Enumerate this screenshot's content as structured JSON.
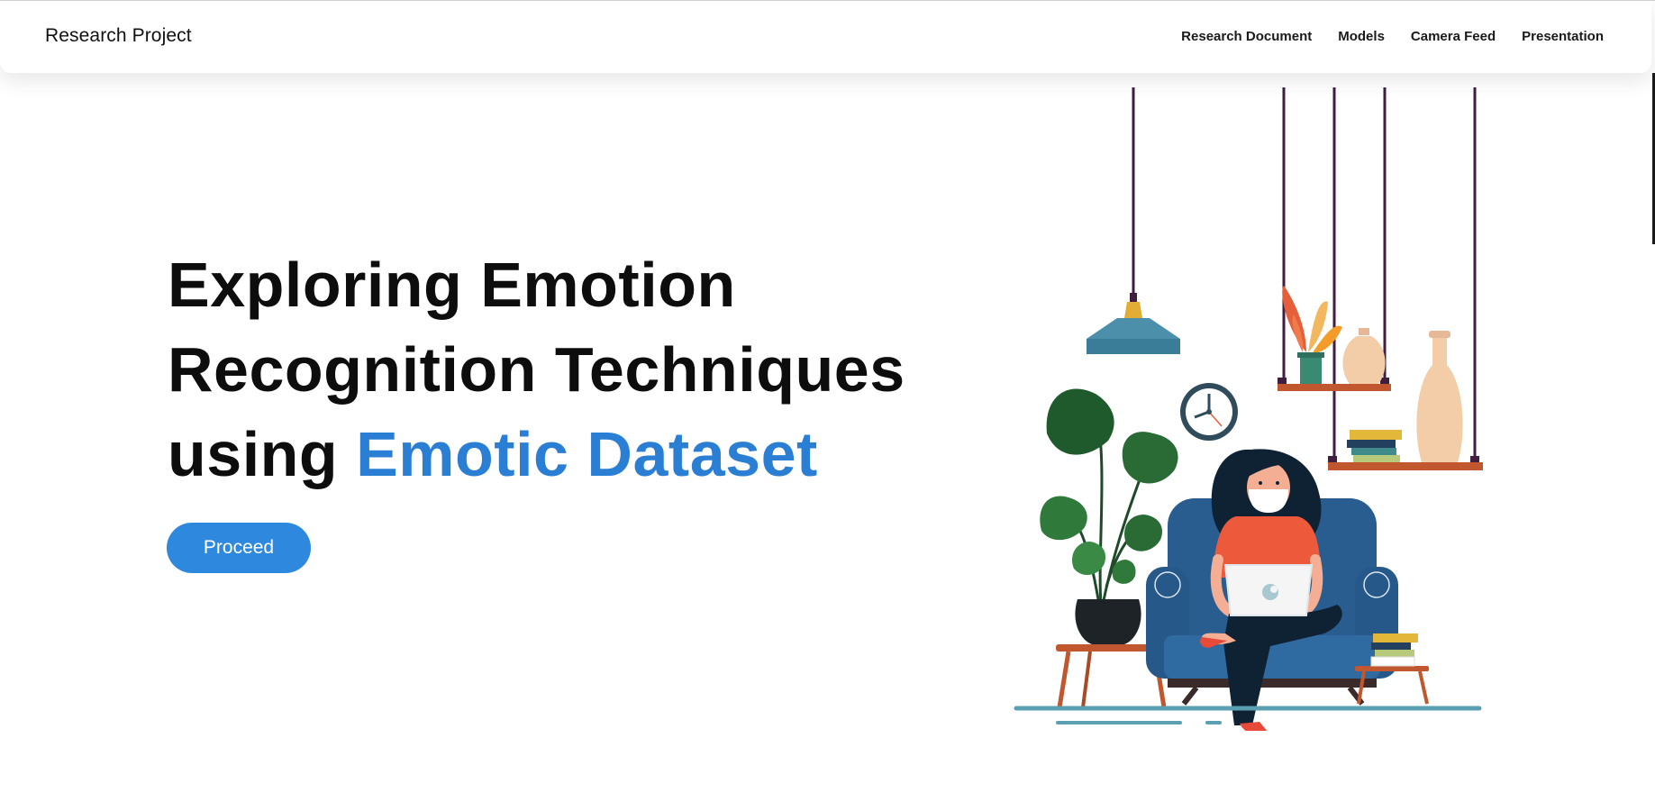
{
  "header": {
    "brand": "Research Project",
    "nav": [
      {
        "label": "Research Document"
      },
      {
        "label": "Models"
      },
      {
        "label": "Camera Feed"
      },
      {
        "label": "Presentation"
      }
    ]
  },
  "hero": {
    "title_line1": "Exploring Emotion",
    "title_line2": "Recognition Techniques",
    "title_line3_prefix": "using ",
    "title_highlight": "Emotic Dataset",
    "button_label": "Proceed"
  },
  "colors": {
    "accent": "#2a7fd4",
    "button": "#2e89de",
    "text": "#0d0d0d"
  },
  "illustration": {
    "subject": "woman-working-on-laptop-in-armchair-icon"
  }
}
